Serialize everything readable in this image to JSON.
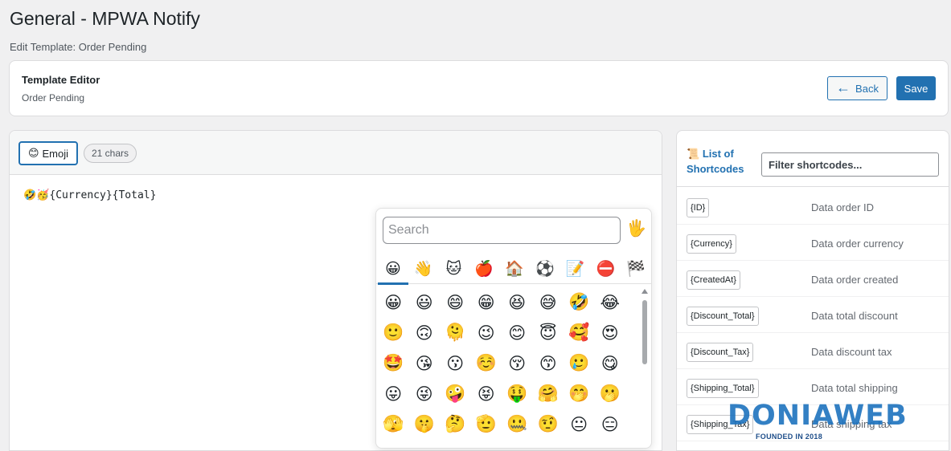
{
  "page": {
    "title": "General - MPWA Notify",
    "subtitle": "Edit Template: Order Pending"
  },
  "header_card": {
    "title": "Template Editor",
    "subtitle": "Order Pending",
    "back_label": "Back",
    "back_icon": "arrow-left-icon",
    "save_label": "Save"
  },
  "editor": {
    "emoji_button_label": "Emoji",
    "emoji_button_icon": "😊",
    "char_count": "21 chars",
    "content": "🤣🥳{Currency}{Total}"
  },
  "emoji_picker": {
    "search_placeholder": "Search",
    "skin_tone_emoji": "🖐️",
    "categories": [
      {
        "name": "smileys",
        "glyph": "😀"
      },
      {
        "name": "people",
        "glyph": "👋"
      },
      {
        "name": "animals",
        "glyph": "🐱"
      },
      {
        "name": "food",
        "glyph": "🍎"
      },
      {
        "name": "travel",
        "glyph": "🏠"
      },
      {
        "name": "activities",
        "glyph": "⚽"
      },
      {
        "name": "objects",
        "glyph": "📝"
      },
      {
        "name": "symbols",
        "glyph": "⛔"
      },
      {
        "name": "flags",
        "glyph": "🏁"
      }
    ],
    "active_category": 0,
    "emojis": [
      "😀",
      "😃",
      "😄",
      "😁",
      "😆",
      "😅",
      "🤣",
      "😂",
      "🙂",
      "🙃",
      "🫠",
      "😉",
      "😊",
      "😇",
      "🥰",
      "😍",
      "🤩",
      "😘",
      "😗",
      "☺️",
      "😚",
      "😙",
      "🥲",
      "😋",
      "😛",
      "😜",
      "🤪",
      "😝",
      "🤑",
      "🤗",
      "🤭",
      "🫢",
      "🫣",
      "🤫",
      "🤔",
      "🫡",
      "🤐",
      "🤨",
      "😐",
      "😑"
    ]
  },
  "shortcodes": {
    "title_emoji": "📜",
    "title": "List of Shortcodes",
    "filter_placeholder": "Filter shortcodes...",
    "items": [
      {
        "code": "{ID}",
        "description": "Data order ID"
      },
      {
        "code": "{Currency}",
        "description": "Data order currency"
      },
      {
        "code": "{CreatedAt}",
        "description": "Data order created"
      },
      {
        "code": "{Discount_Total}",
        "description": "Data total discount"
      },
      {
        "code": "{Discount_Tax}",
        "description": "Data discount tax"
      },
      {
        "code": "{Shipping_Total}",
        "description": "Data total shipping"
      },
      {
        "code": "{Shipping_Tax}",
        "description": "Data shipping tax"
      }
    ]
  },
  "watermark": {
    "main": "DONIAWEB",
    "sub": "FOUNDED IN 2018"
  },
  "colors": {
    "accent": "#2271b1",
    "background": "#f0f0f1",
    "watermark": "#1e73be"
  }
}
